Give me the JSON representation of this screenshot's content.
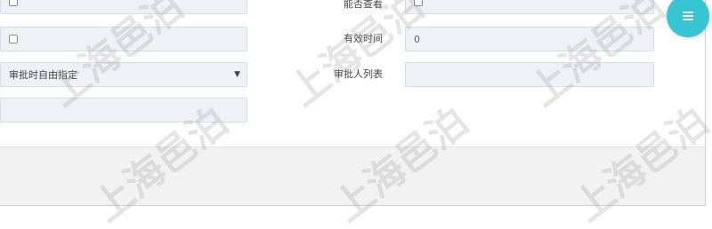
{
  "form": {
    "row1": {
      "right_label": "能否查看"
    },
    "row2": {
      "right_label": "有效时间",
      "right_value": "0"
    },
    "row3": {
      "left_select_value": "审批时自由指定",
      "right_label": "审批人列表"
    }
  },
  "fab": {
    "icon": "menu-icon",
    "color": "#36c6d3"
  },
  "watermark": {
    "text": "上海邑泊"
  }
}
